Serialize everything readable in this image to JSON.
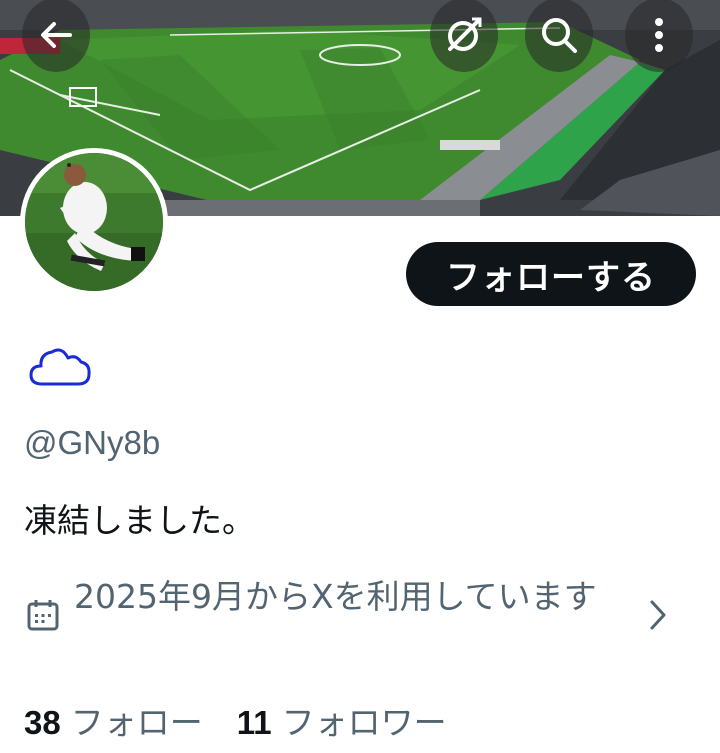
{
  "banner": {
    "description_icon": "stadium-photo"
  },
  "header": {
    "back_icon": "back-arrow-icon",
    "premium_icon": "x-premium-icon",
    "search_icon": "search-icon",
    "more_icon": "more-vertical-icon"
  },
  "profile": {
    "follow_label": "フォローする",
    "handle": "@GNy8b",
    "bio": "凍結しました。",
    "joined_text": "2025年9月からXを利用しています",
    "following_count": "38",
    "following_label": "フォロー",
    "followers_count": "11",
    "followers_label": "フォロワー"
  },
  "colors": {
    "text_primary": "#0f1419",
    "text_secondary": "#536471",
    "cloud_outline": "#1a2cd6",
    "button_bg": "#0f1419"
  }
}
